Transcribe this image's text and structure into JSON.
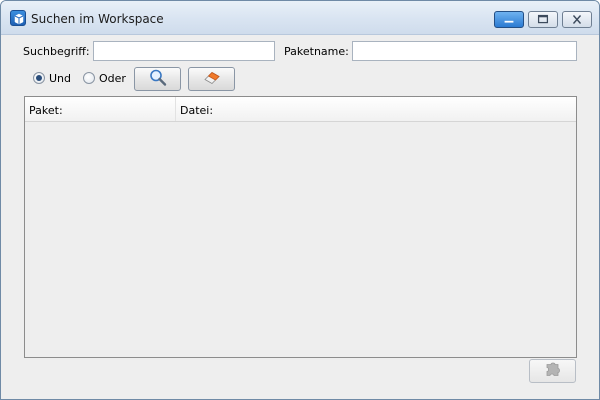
{
  "window": {
    "title": "Suchen im Workspace"
  },
  "search": {
    "term_label": "Suchbegriff:",
    "term_value": "",
    "package_label": "Paketname:",
    "package_value": ""
  },
  "mode": {
    "and_label": "Und",
    "or_label": "Oder",
    "selected": "Und"
  },
  "toolbar": {
    "search_icon": "magnifier-icon",
    "clear_icon": "eraser-icon"
  },
  "results": {
    "columns": [
      "Paket:",
      "Datei:"
    ],
    "rows": []
  },
  "footer": {
    "action_icon": "puzzle-piece-icon",
    "action_enabled": false
  }
}
